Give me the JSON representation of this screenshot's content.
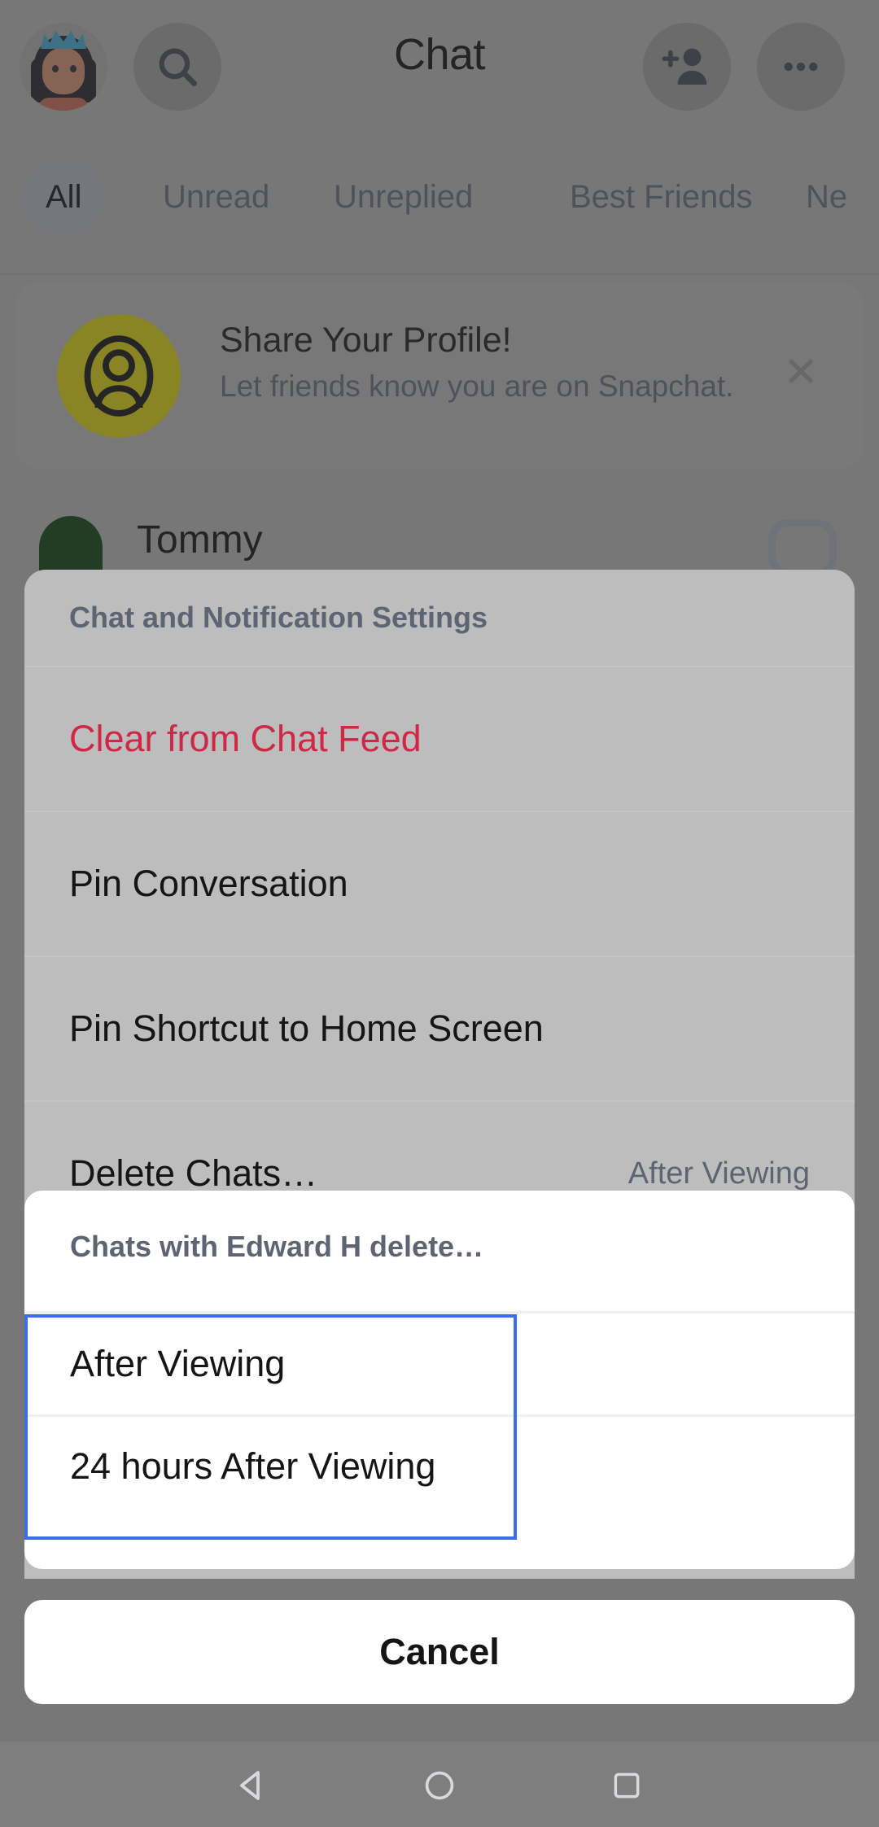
{
  "app": {
    "title": "Chat"
  },
  "topbar": {
    "avatar_icon": "bitmoji-avatar",
    "search_icon": "search-icon",
    "add_friend_icon": "add-friend-icon",
    "more_icon": "more-options-icon"
  },
  "filter_tabs": [
    {
      "label": "All",
      "active": true
    },
    {
      "label": "Unread",
      "active": false
    },
    {
      "label": "Unreplied",
      "active": false
    },
    {
      "label": "Best Friends",
      "active": false
    },
    {
      "label": "Ne",
      "active": false
    }
  ],
  "promo_banner": {
    "title": "Share Your Profile!",
    "subtitle": "Let friends know you are on Snapchat.",
    "avatar_icon": "person-outline-icon",
    "avatar_color": "#c9c00f",
    "close_icon": "close-icon",
    "close_glyph": "✕"
  },
  "chat_list": [
    {
      "name": "Tommy",
      "avatar_color": "#0d3d12",
      "status_icon": "chat-bubble-icon"
    }
  ],
  "action_sheet": {
    "header": "Chat and Notification Settings",
    "rows": [
      {
        "label": "Clear from Chat Feed",
        "value": "",
        "destructive": true
      },
      {
        "label": "Pin Conversation",
        "value": "",
        "destructive": false
      },
      {
        "label": "Pin Shortcut to Home Screen",
        "value": "",
        "destructive": false
      },
      {
        "label": "Delete Chats…",
        "value": "After Viewing",
        "destructive": false
      }
    ]
  },
  "delete_chats_dialog": {
    "title": "Chats with Edward H delete…",
    "options": [
      {
        "label": "After Viewing",
        "selected": true
      },
      {
        "label": "24 hours After Viewing",
        "selected": true
      }
    ],
    "selection_border_color": "#3b6fe8"
  },
  "cancel_button": {
    "label": "Cancel"
  },
  "android_navbar": {
    "back_icon": "triangle-back-icon",
    "home_icon": "circle-home-icon",
    "recents_icon": "square-recents-icon"
  }
}
